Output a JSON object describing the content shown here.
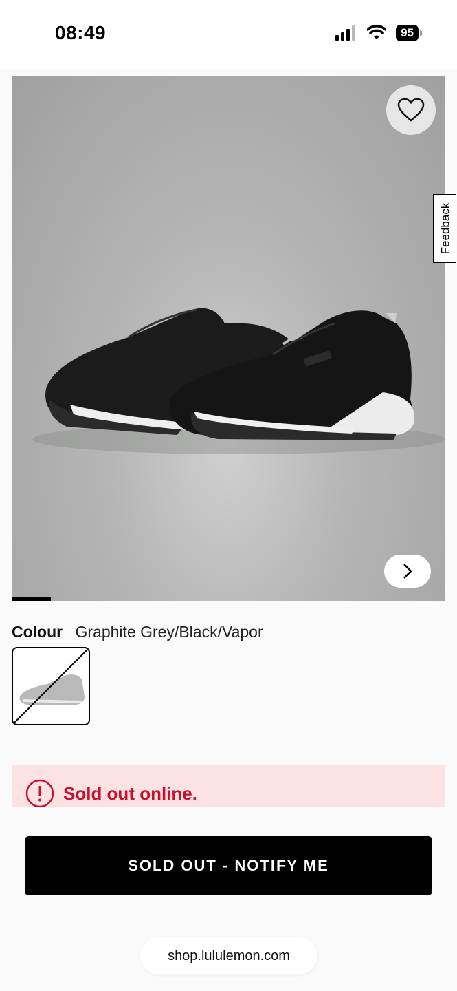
{
  "status_bar": {
    "time": "08:49",
    "battery": "95",
    "icons": [
      "signal-icon",
      "wifi-icon",
      "battery-icon"
    ]
  },
  "gallery": {
    "wishlist_icon": "heart-icon",
    "next_icon": "chevron-right-icon",
    "image_count_progress": 0.09
  },
  "feedback": {
    "label": "Feedback"
  },
  "colour": {
    "label": "Colour",
    "value": "Graphite Grey/Black/Vapor"
  },
  "alert": {
    "icon": "alert-circle-icon",
    "message": "Sold out online.",
    "color": "#c8102e"
  },
  "cta": {
    "label": "SOLD OUT - NOTIFY ME"
  },
  "browser": {
    "url": "shop.lululemon.com"
  }
}
